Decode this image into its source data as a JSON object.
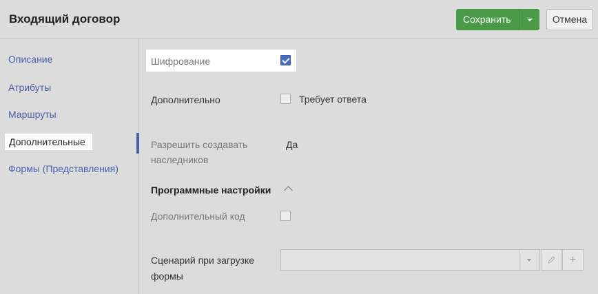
{
  "header": {
    "title": "Входящий договор",
    "save_label": "Сохранить",
    "cancel_label": "Отмена"
  },
  "sidebar": {
    "items": [
      {
        "label": "Описание",
        "active": false
      },
      {
        "label": "Атрибуты",
        "active": false
      },
      {
        "label": "Маршруты",
        "active": false
      },
      {
        "label": "Дополнительные",
        "active": true
      },
      {
        "label": "Формы (Представления)",
        "active": false
      }
    ]
  },
  "form": {
    "encryption": {
      "label": "Шифрование",
      "checked": true
    },
    "additional": {
      "label": "Дополнительно",
      "option_label": "Требует ответа",
      "checked": false
    },
    "allow_heirs": {
      "label_line1": "Разрешить создавать",
      "label_line2": "наследников",
      "value": "Да"
    },
    "program_section": {
      "title": "Программные настройки"
    },
    "extra_code": {
      "label": "Дополнительный код",
      "checked": false
    },
    "load_script": {
      "label_line1": "Сценарий при загрузке",
      "label_line2": "формы",
      "value": ""
    }
  },
  "colors": {
    "accent": "#4a5ea8",
    "save_green": "#4a9a48",
    "checkbox_blue": "#4a6cc0"
  }
}
